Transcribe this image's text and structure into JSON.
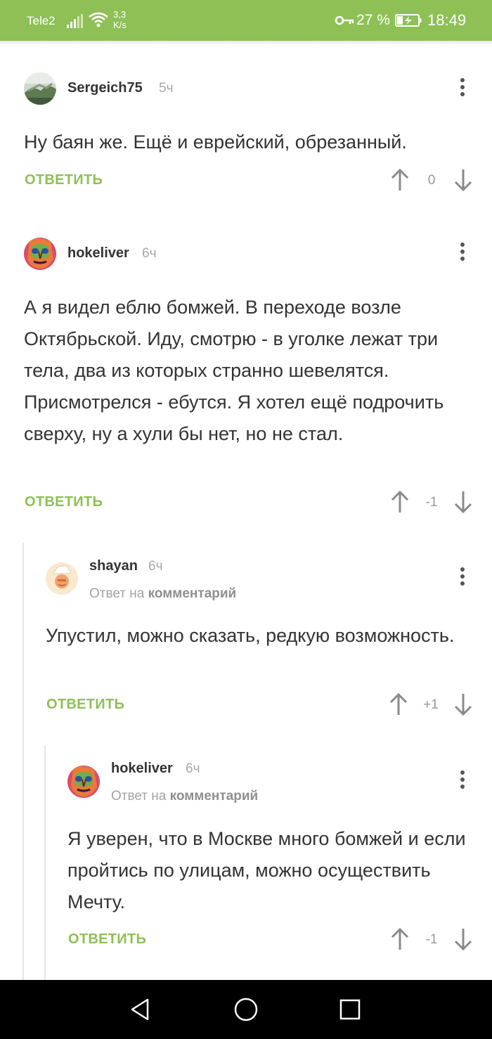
{
  "status_bar": {
    "carrier": "Tele2",
    "speed_value": "3,3",
    "speed_unit": "K/s",
    "battery": "27 %",
    "time": "18:49"
  },
  "comments": [
    {
      "username": "Sergeich75",
      "time": "5ч",
      "text": "Ну баян же. Ещё и еврейский, обрезанный.",
      "reply_label": "ОТВЕТИТЬ",
      "rating": "0"
    },
    {
      "username": "hokeliver",
      "time": "6ч",
      "text": "А я видел еблю бомжей. В переходе возле Октябрьской. Иду, смотрю - в уголке лежат три тела, два из которых странно шевелятся. Присмотрелся - ебутся. Я хотел ещё подрочить сверху, ну а хули бы нет, но не стал.",
      "reply_label": "ОТВЕТИТЬ",
      "rating": "-1"
    },
    {
      "username": "shayan",
      "time": "6ч",
      "reply_prefix": "Ответ на",
      "reply_target": "комментарий",
      "text": "Упустил, можно сказать, редкую возможность.",
      "reply_label": "ОТВЕТИТЬ",
      "rating": "+1"
    },
    {
      "username": "hokeliver",
      "time": "6ч",
      "reply_prefix": "Ответ на",
      "reply_target": "комментарий",
      "text": "Я уверен, что в Москве много бомжей и если пройтись по улицам, можно осуществить Мечту.",
      "reply_label": "ОТВЕТИТЬ",
      "rating": "-1"
    }
  ],
  "nav_bar": {
    "icons": [
      "back-icon",
      "home-icon",
      "recents-icon"
    ]
  },
  "colors": {
    "accent": "#8ec056",
    "status_bar_bg": "#8ec056"
  }
}
